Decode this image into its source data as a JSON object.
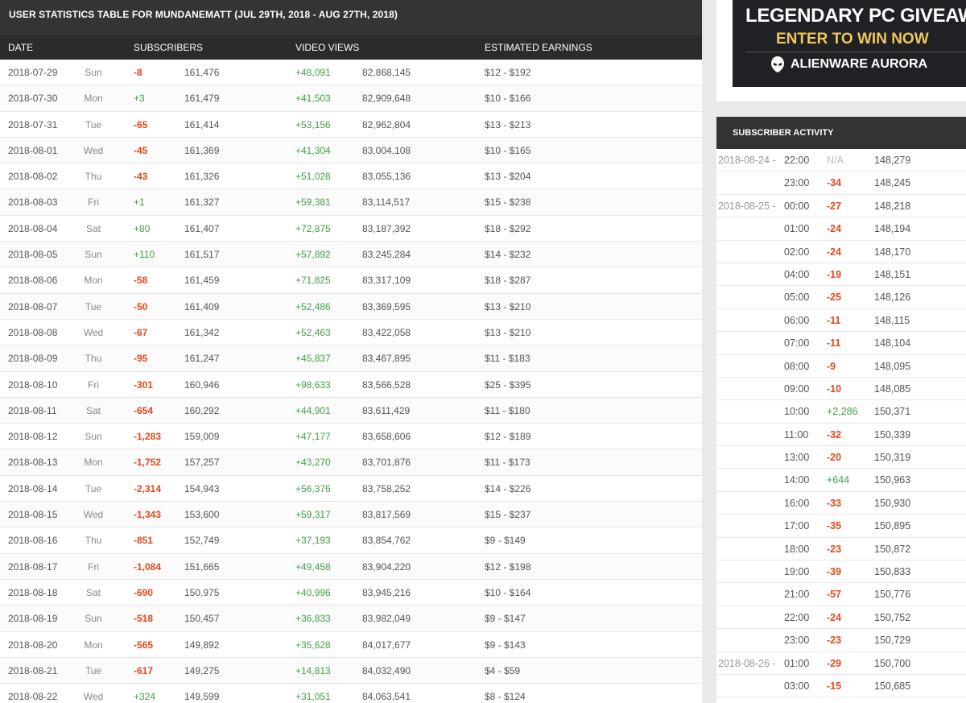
{
  "table": {
    "title": "USER STATISTICS TABLE FOR MUNDANEMATT (JUL 29TH, 2018 - AUG 27TH, 2018)",
    "columns": {
      "date": "DATE",
      "subscribers": "SUBSCRIBERS",
      "video_views": "VIDEO VIEWS",
      "earnings": "ESTIMATED EARNINGS"
    },
    "rows": [
      {
        "date": "2018-07-29",
        "day": "Sun",
        "sub_delta": "-8",
        "sub_total": "161,476",
        "view_delta": "+48,091",
        "view_total": "82,868,145",
        "earnings": "$12  -  $192"
      },
      {
        "date": "2018-07-30",
        "day": "Mon",
        "sub_delta": "+3",
        "sub_total": "161,479",
        "view_delta": "+41,503",
        "view_total": "82,909,648",
        "earnings": "$10  -  $166"
      },
      {
        "date": "2018-07-31",
        "day": "Tue",
        "sub_delta": "-65",
        "sub_total": "161,414",
        "view_delta": "+53,156",
        "view_total": "82,962,804",
        "earnings": "$13  -  $213"
      },
      {
        "date": "2018-08-01",
        "day": "Wed",
        "sub_delta": "-45",
        "sub_total": "161,369",
        "view_delta": "+41,304",
        "view_total": "83,004,108",
        "earnings": "$10  -  $165"
      },
      {
        "date": "2018-08-02",
        "day": "Thu",
        "sub_delta": "-43",
        "sub_total": "161,326",
        "view_delta": "+51,028",
        "view_total": "83,055,136",
        "earnings": "$13  -  $204"
      },
      {
        "date": "2018-08-03",
        "day": "Fri",
        "sub_delta": "+1",
        "sub_total": "161,327",
        "view_delta": "+59,381",
        "view_total": "83,114,517",
        "earnings": "$15  -  $238"
      },
      {
        "date": "2018-08-04",
        "day": "Sat",
        "sub_delta": "+80",
        "sub_total": "161,407",
        "view_delta": "+72,875",
        "view_total": "83,187,392",
        "earnings": "$18  -  $292"
      },
      {
        "date": "2018-08-05",
        "day": "Sun",
        "sub_delta": "+110",
        "sub_total": "161,517",
        "view_delta": "+57,892",
        "view_total": "83,245,284",
        "earnings": "$14  -  $232"
      },
      {
        "date": "2018-08-06",
        "day": "Mon",
        "sub_delta": "-58",
        "sub_total": "161,459",
        "view_delta": "+71,825",
        "view_total": "83,317,109",
        "earnings": "$18  -  $287"
      },
      {
        "date": "2018-08-07",
        "day": "Tue",
        "sub_delta": "-50",
        "sub_total": "161,409",
        "view_delta": "+52,486",
        "view_total": "83,369,595",
        "earnings": "$13  -  $210"
      },
      {
        "date": "2018-08-08",
        "day": "Wed",
        "sub_delta": "-67",
        "sub_total": "161,342",
        "view_delta": "+52,463",
        "view_total": "83,422,058",
        "earnings": "$13  -  $210"
      },
      {
        "date": "2018-08-09",
        "day": "Thu",
        "sub_delta": "-95",
        "sub_total": "161,247",
        "view_delta": "+45,837",
        "view_total": "83,467,895",
        "earnings": "$11  -  $183"
      },
      {
        "date": "2018-08-10",
        "day": "Fri",
        "sub_delta": "-301",
        "sub_total": "160,946",
        "view_delta": "+98,633",
        "view_total": "83,566,528",
        "earnings": "$25  -  $395"
      },
      {
        "date": "2018-08-11",
        "day": "Sat",
        "sub_delta": "-654",
        "sub_total": "160,292",
        "view_delta": "+44,901",
        "view_total": "83,611,429",
        "earnings": "$11  -  $180"
      },
      {
        "date": "2018-08-12",
        "day": "Sun",
        "sub_delta": "-1,283",
        "sub_total": "159,009",
        "view_delta": "+47,177",
        "view_total": "83,658,606",
        "earnings": "$12  -  $189"
      },
      {
        "date": "2018-08-13",
        "day": "Mon",
        "sub_delta": "-1,752",
        "sub_total": "157,257",
        "view_delta": "+43,270",
        "view_total": "83,701,876",
        "earnings": "$11  -  $173"
      },
      {
        "date": "2018-08-14",
        "day": "Tue",
        "sub_delta": "-2,314",
        "sub_total": "154,943",
        "view_delta": "+56,376",
        "view_total": "83,758,252",
        "earnings": "$14  -  $226"
      },
      {
        "date": "2018-08-15",
        "day": "Wed",
        "sub_delta": "-1,343",
        "sub_total": "153,600",
        "view_delta": "+59,317",
        "view_total": "83,817,569",
        "earnings": "$15  -  $237"
      },
      {
        "date": "2018-08-16",
        "day": "Thu",
        "sub_delta": "-851",
        "sub_total": "152,749",
        "view_delta": "+37,193",
        "view_total": "83,854,762",
        "earnings": "$9  -  $149"
      },
      {
        "date": "2018-08-17",
        "day": "Fri",
        "sub_delta": "-1,084",
        "sub_total": "151,665",
        "view_delta": "+49,458",
        "view_total": "83,904,220",
        "earnings": "$12  -  $198"
      },
      {
        "date": "2018-08-18",
        "day": "Sat",
        "sub_delta": "-690",
        "sub_total": "150,975",
        "view_delta": "+40,996",
        "view_total": "83,945,216",
        "earnings": "$10  -  $164"
      },
      {
        "date": "2018-08-19",
        "day": "Sun",
        "sub_delta": "-518",
        "sub_total": "150,457",
        "view_delta": "+36,833",
        "view_total": "83,982,049",
        "earnings": "$9  -  $147"
      },
      {
        "date": "2018-08-20",
        "day": "Mon",
        "sub_delta": "-565",
        "sub_total": "149,892",
        "view_delta": "+35,628",
        "view_total": "84,017,677",
        "earnings": "$9  -  $143"
      },
      {
        "date": "2018-08-21",
        "day": "Tue",
        "sub_delta": "-617",
        "sub_total": "149,275",
        "view_delta": "+14,813",
        "view_total": "84,032,490",
        "earnings": "$4  -  $59"
      },
      {
        "date": "2018-08-22",
        "day": "Wed",
        "sub_delta": "+324",
        "sub_total": "149,599",
        "view_delta": "+31,051",
        "view_total": "84,063,541",
        "earnings": "$8  -  $124"
      }
    ]
  },
  "ad": {
    "line1": "LEGENDARY PC GIVEAWAY",
    "line2": "ENTER TO WIN NOW",
    "line3": "ALIENWARE AURORA",
    "logo_icon": "alien-head-icon",
    "accent_color": "#f1c75a"
  },
  "activity": {
    "title": "SUBSCRIBER ACTIVITY",
    "rows": [
      {
        "date": "2018-08-24 -",
        "time": "22:00",
        "delta": "N/A",
        "total": "148,279"
      },
      {
        "date": "",
        "time": "23:00",
        "delta": "-34",
        "total": "148,245"
      },
      {
        "date": "2018-08-25 -",
        "time": "00:00",
        "delta": "-27",
        "total": "148,218"
      },
      {
        "date": "",
        "time": "01:00",
        "delta": "-24",
        "total": "148,194"
      },
      {
        "date": "",
        "time": "02:00",
        "delta": "-24",
        "total": "148,170"
      },
      {
        "date": "",
        "time": "04:00",
        "delta": "-19",
        "total": "148,151"
      },
      {
        "date": "",
        "time": "05:00",
        "delta": "-25",
        "total": "148,126"
      },
      {
        "date": "",
        "time": "06:00",
        "delta": "-11",
        "total": "148,115"
      },
      {
        "date": "",
        "time": "07:00",
        "delta": "-11",
        "total": "148,104"
      },
      {
        "date": "",
        "time": "08:00",
        "delta": "-9",
        "total": "148,095"
      },
      {
        "date": "",
        "time": "09:00",
        "delta": "-10",
        "total": "148,085"
      },
      {
        "date": "",
        "time": "10:00",
        "delta": "+2,286",
        "total": "150,371"
      },
      {
        "date": "",
        "time": "11:00",
        "delta": "-32",
        "total": "150,339"
      },
      {
        "date": "",
        "time": "13:00",
        "delta": "-20",
        "total": "150,319"
      },
      {
        "date": "",
        "time": "14:00",
        "delta": "+644",
        "total": "150,963"
      },
      {
        "date": "",
        "time": "16:00",
        "delta": "-33",
        "total": "150,930"
      },
      {
        "date": "",
        "time": "17:00",
        "delta": "-35",
        "total": "150,895"
      },
      {
        "date": "",
        "time": "18:00",
        "delta": "-23",
        "total": "150,872"
      },
      {
        "date": "",
        "time": "19:00",
        "delta": "-39",
        "total": "150,833"
      },
      {
        "date": "",
        "time": "21:00",
        "delta": "-57",
        "total": "150,776"
      },
      {
        "date": "",
        "time": "22:00",
        "delta": "-24",
        "total": "150,752"
      },
      {
        "date": "",
        "time": "23:00",
        "delta": "-23",
        "total": "150,729"
      },
      {
        "date": "2018-08-26 -",
        "time": "01:00",
        "delta": "-29",
        "total": "150,700"
      },
      {
        "date": "",
        "time": "03:00",
        "delta": "-15",
        "total": "150,685"
      }
    ]
  },
  "colors": {
    "positive": "#43a047",
    "negative": "#e5471b",
    "header_bg": "#343434"
  }
}
